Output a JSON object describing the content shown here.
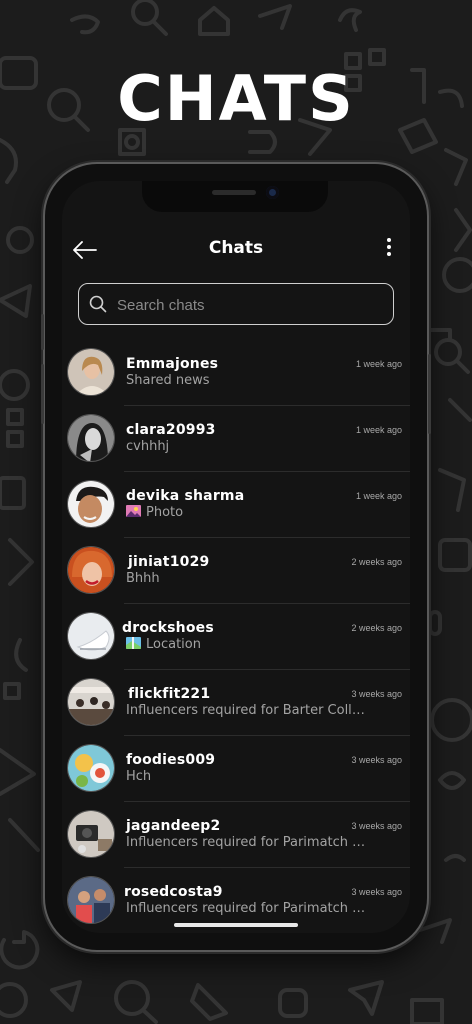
{
  "promo": {
    "headline": "CHATS"
  },
  "header": {
    "title": "Chats"
  },
  "search": {
    "placeholder": "Search chats"
  },
  "chats": [
    {
      "name": "Emmajones",
      "time": "1 week ago",
      "preview": "Shared news"
    },
    {
      "name": "clara20993",
      "time": "1 week ago",
      "preview": "cvhhhj"
    },
    {
      "name": "devika sharma",
      "time": "1 week ago",
      "preview": "Photo",
      "preview_icon": "photo-icon"
    },
    {
      "name": "jiniat1029",
      "time": "2 weeks ago",
      "preview": "Bhhh"
    },
    {
      "name": "drockshoes",
      "time": "2 weeks ago",
      "preview": "Location",
      "preview_icon": "map-icon"
    },
    {
      "name": "flickfit221",
      "time": "3 weeks ago",
      "preview": "Influencers required for Barter Colla..."
    },
    {
      "name": "foodies009",
      "time": "3 weeks ago",
      "preview": "Hch"
    },
    {
      "name": "jagandeep2",
      "time": "3 weeks ago",
      "preview": "Influencers required for Parimatch L..."
    },
    {
      "name": "rosedcosta9",
      "time": "3 weeks ago",
      "preview": "Influencers required for Parimatch L..."
    }
  ],
  "colors": {
    "background": "#1c1c1c",
    "screen": "#141414",
    "text_primary": "#ffffff",
    "text_secondary": "#a3a3a3"
  }
}
